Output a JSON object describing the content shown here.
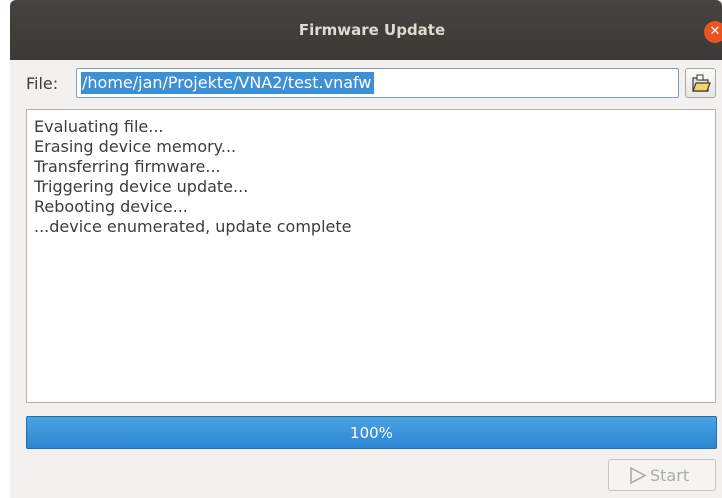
{
  "window": {
    "title": "Firmware Update",
    "close_icon": "close-icon"
  },
  "file": {
    "label": "File:",
    "path": "/home/jan/Projekte/VNA2/test.vnafw",
    "browse_icon": "open-folder-icon"
  },
  "log": {
    "lines": [
      "Evaluating file...",
      "Erasing device memory...",
      "Transferring firmware...",
      "Triggering device update...",
      "Rebooting device...",
      "...device enumerated, update complete"
    ]
  },
  "progress": {
    "value": 100,
    "text": "100%"
  },
  "start_button": {
    "label": "Start",
    "icon": "play-icon",
    "enabled": false
  },
  "colors": {
    "titlebar": "#3e3d39",
    "accent": "#3d8fd6",
    "close": "#e95420",
    "progress": "#3a93da"
  }
}
